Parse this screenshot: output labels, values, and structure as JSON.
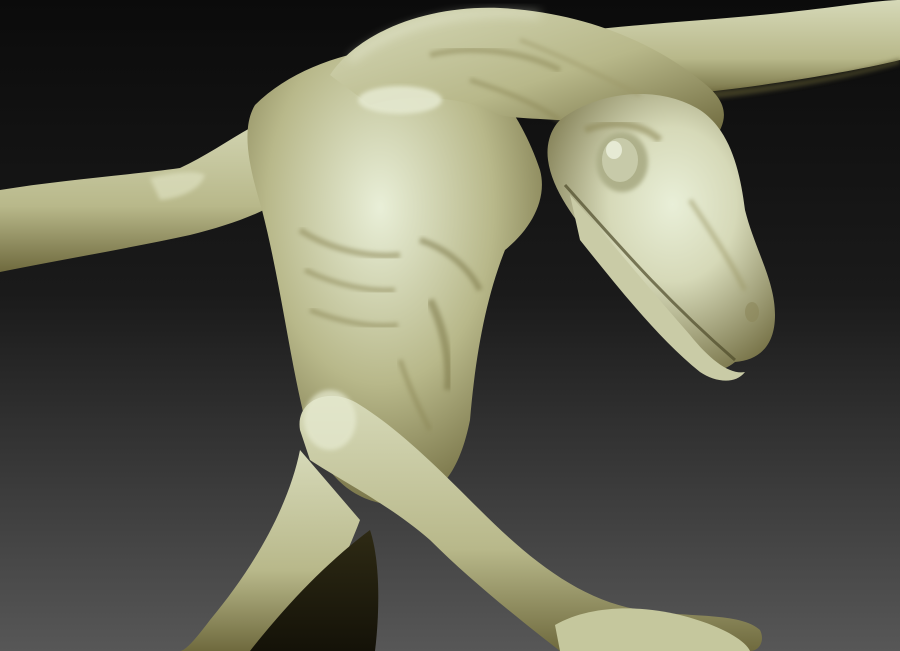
{
  "scene": {
    "subject": "sculpted-creature",
    "colors": {
      "background_top": "#0b0b0b",
      "background_mid": "#1a1a1a",
      "background_bottom": "#575757",
      "clay_light": "#d6d9b8",
      "clay_mid": "#b8b88a",
      "clay_shadow": "#6f6a3e",
      "clay_deep_shadow": "#2e2a14",
      "rim_light": "#e9efd8"
    }
  }
}
